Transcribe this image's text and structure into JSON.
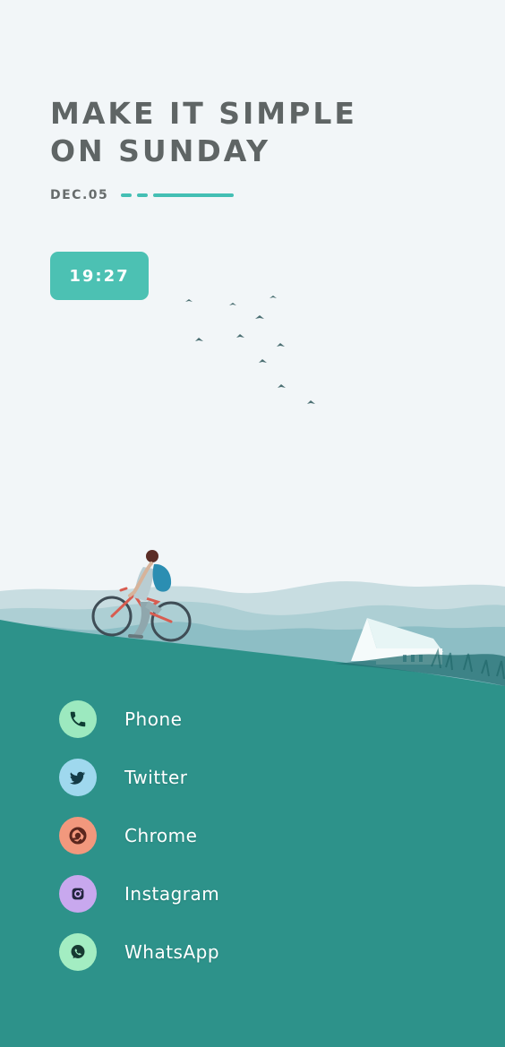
{
  "headline": {
    "line1": "MAKE IT SIMPLE",
    "line2": "ON SUNDAY"
  },
  "date": "DEC.05",
  "time": "19:27",
  "colors": {
    "accent": "#44bfb4",
    "ground": "#2d928a",
    "phone": "#9ce9bf",
    "twitter": "#9fd8ee",
    "chrome": "#f2987d",
    "instagram": "#c8a8ee",
    "whatsapp": "#a3edc2"
  },
  "apps": [
    {
      "label": "Phone",
      "icon": "phone-icon"
    },
    {
      "label": "Twitter",
      "icon": "twitter-icon"
    },
    {
      "label": "Chrome",
      "icon": "chrome-icon"
    },
    {
      "label": "Instagram",
      "icon": "instagram-icon"
    },
    {
      "label": "WhatsApp",
      "icon": "whatsapp-icon"
    }
  ]
}
